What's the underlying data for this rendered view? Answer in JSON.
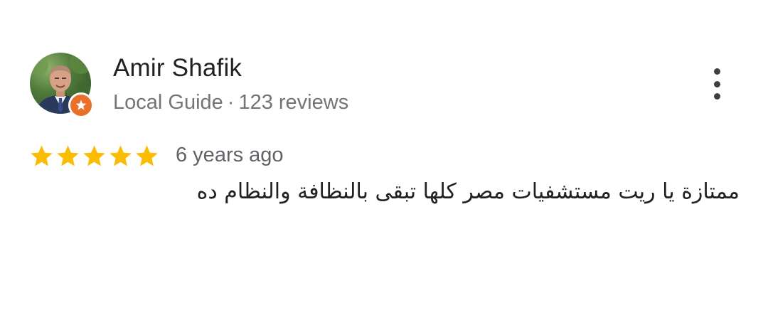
{
  "reviewer": {
    "name": "Amir Shafik",
    "badge": "Local Guide",
    "separator": "·",
    "review_count": "123 reviews",
    "avatar_icon": "profile-photo",
    "guide_badge_icon": "local-guide-star-badge",
    "guide_badge_color": "#e8702a"
  },
  "review": {
    "rating": 5,
    "max_rating": 5,
    "star_color": "#fbbc04",
    "time_ago": "6 years ago",
    "text": "ممتازة يا ريت مستشفيات مصر كلها تبقى بالنظافة والنظام ده"
  },
  "menu": {
    "icon": "more-vert-icon"
  }
}
